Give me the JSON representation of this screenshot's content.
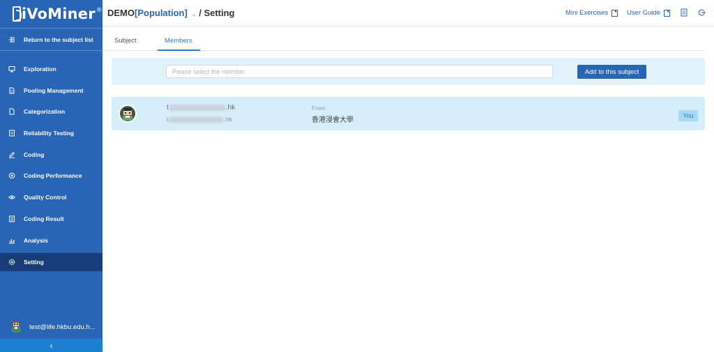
{
  "app": {
    "logo_text": "iVoMiner",
    "logo_mark": "®"
  },
  "sidebar": {
    "return_label": "Return to the subject list",
    "items": [
      {
        "label": "Exploration",
        "icon": "monitor-icon"
      },
      {
        "label": "Pooling Management",
        "icon": "document-icon"
      },
      {
        "label": "Categorization",
        "icon": "file-icon"
      },
      {
        "label": "Reliability Testing",
        "icon": "checklist-icon"
      },
      {
        "label": "Coding",
        "icon": "pencil-icon"
      },
      {
        "label": "Coding Performance",
        "icon": "circle-icon"
      },
      {
        "label": "Quality Control",
        "icon": "eye-icon"
      },
      {
        "label": "Coding Result",
        "icon": "list-icon"
      },
      {
        "label": "Analysis",
        "icon": "bar-chart-icon"
      },
      {
        "label": "Setting",
        "icon": "gear-icon",
        "active": true
      }
    ],
    "user_email": "test@life.hkbu.edu.h...",
    "collapse_glyph": "‹"
  },
  "header": {
    "prefix": "DEMO",
    "project": "[Population]",
    "chevron": "⌄",
    "suffix": "/ Setting",
    "mini_exercises": "Mini Exercises",
    "user_guide": "User Guide"
  },
  "tabs": [
    {
      "label": "Subject",
      "active": false
    },
    {
      "label": "Members",
      "active": true
    }
  ],
  "select_bar": {
    "placeholder": "Please select the member",
    "add_button": "Add to this subject"
  },
  "member": {
    "name_start": "t",
    "name_end": ".hk",
    "email_start": "t",
    "email_end": ".hk",
    "from_label": "From",
    "from_value": "香港浸會大學",
    "badge": "You"
  },
  "colors": {
    "sidebar": "#2a64b4",
    "sidebar_active": "#173d78",
    "accent": "#2a80d8",
    "row_bg": "#d6eef9",
    "bar_bg": "#e1f2fb"
  }
}
